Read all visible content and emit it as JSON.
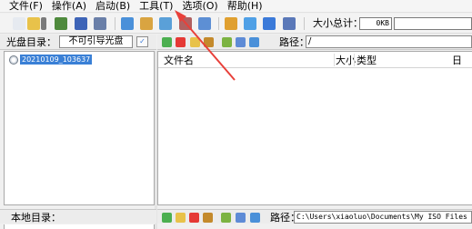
{
  "menubar": {
    "items": [
      {
        "name": "menu-file",
        "label": "文件(F)"
      },
      {
        "name": "menu-operation",
        "label": "操作(A)"
      },
      {
        "name": "menu-boot",
        "label": "启动(B)"
      },
      {
        "name": "menu-tools",
        "label": "工具(T)"
      },
      {
        "name": "menu-options",
        "label": "选项(O)"
      },
      {
        "name": "menu-help",
        "label": "帮助(H)"
      }
    ]
  },
  "toolbar": {
    "icons": [
      {
        "name": "new-file-icon",
        "color": "#e6eaf0"
      },
      {
        "name": "open-folder-icon",
        "color": "#e8c24a"
      },
      {
        "name": "open-dropdown-icon",
        "color": "#7a7a7a"
      },
      {
        "name": "find-icon",
        "color": "#4f8a3d"
      },
      {
        "name": "save-icon",
        "color": "#3e64b7"
      },
      {
        "name": "save-as-icon",
        "color": "#6a7fa8"
      },
      {
        "name": "properties-icon",
        "color": "#4a90d9"
      },
      {
        "name": "burn-disc-icon",
        "color": "#d9a441"
      },
      {
        "name": "mount-icon",
        "color": "#5aa0d8"
      },
      {
        "name": "compress-icon",
        "color": "#b06060"
      },
      {
        "name": "make-image-icon",
        "color": "#5d8fd4"
      },
      {
        "name": "extract-icon",
        "color": "#e0a030"
      },
      {
        "name": "info-icon",
        "color": "#4fa0e6"
      },
      {
        "name": "help-icon",
        "color": "#3b7ad9"
      },
      {
        "name": "exit-icon",
        "color": "#5a78b8"
      }
    ],
    "size_total_label": "大小总计：",
    "size_total_value": "0KB"
  },
  "disc_panel": {
    "label": "光盘目录：",
    "boot_type": "不可引导光盘",
    "tree_root_label": "20210109_103637"
  },
  "file_panel": {
    "path_label": "路径：",
    "path_value": "/",
    "columns": [
      "文件名",
      "大小",
      "类型",
      "日"
    ]
  },
  "local_panel": {
    "label": "本地目录：",
    "path_label": "路径：",
    "path_value": "C:\\Users\\xiaoluo\\Documents\\My ISO Files"
  },
  "pane_icons": [
    {
      "name": "up-level-icon",
      "color": "#4caf50"
    },
    {
      "name": "delete-icon",
      "color": "#e53935"
    },
    {
      "name": "new-folder-icon",
      "color": "#e8c24a"
    },
    {
      "name": "rename-icon",
      "color": "#c48a2c"
    },
    {
      "name": "add-icon",
      "color": "#7cb342"
    },
    {
      "name": "settings-icon",
      "color": "#5e8bd6"
    },
    {
      "name": "refresh-icon",
      "color": "#4a90d9"
    }
  ],
  "annotation_color": "#e8403a"
}
